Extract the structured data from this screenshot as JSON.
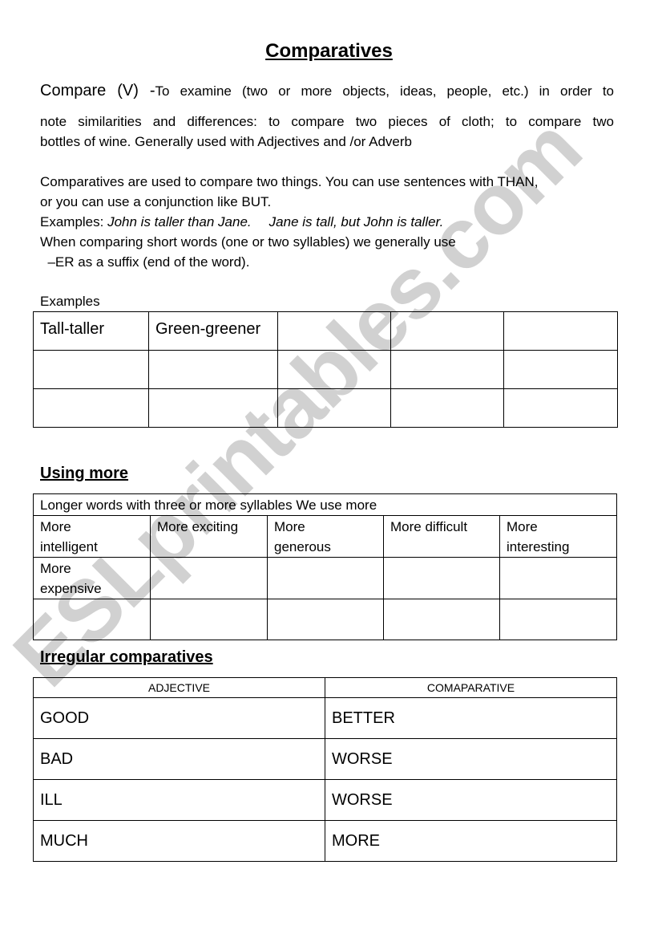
{
  "document": {
    "title": "Comparatives",
    "definition": {
      "term": "Compare (V) -",
      "line1_rest": "To examine (two or more objects, ideas, people, etc.) in order to",
      "line2": "note similarities and differences: to compare two pieces of cloth; to compare two",
      "line3": "bottles of wine. Generally used with Adjectives and /or Adverb"
    },
    "intro": {
      "line1": "Comparatives are used to compare two things. You can use sentences with THAN,",
      "line2": "or you can use a conjunction like BUT.",
      "examples_prefix": "Examples: ",
      "example1": "John is taller than Jane.",
      "example2": "Jane is tall, but John is taller.",
      "line4": "When comparing short words (one or two syllables) we generally use",
      "line5": "  –ER as a suffix (end of the word)."
    },
    "examples_label": "Examples",
    "er_table": {
      "rows": [
        [
          "Tall-taller",
          "Green-greener",
          "",
          "",
          ""
        ],
        [
          "",
          "",
          "",
          "",
          ""
        ],
        [
          "",
          "",
          "",
          "",
          ""
        ]
      ]
    },
    "using_more": {
      "heading": "Using more",
      "header": "Longer words with three or more syllables We use more",
      "rows": [
        [
          "More\nintelligent",
          "More exciting",
          "More\ngenerous",
          "More difficult",
          "More\ninteresting"
        ],
        [
          "More\nexpensive",
          "",
          "",
          "",
          ""
        ],
        [
          "",
          "",
          "",
          "",
          ""
        ]
      ]
    },
    "irregular": {
      "heading": "Irregular comparatives",
      "columns": [
        "ADJECTIVE",
        "COMAPARATIVE"
      ],
      "rows": [
        [
          "GOOD",
          "BETTER"
        ],
        [
          "BAD",
          "WORSE"
        ],
        [
          "ILL",
          "WORSE"
        ],
        [
          "MUCH",
          "MORE"
        ]
      ]
    },
    "watermark": "ESLprintables.com"
  }
}
